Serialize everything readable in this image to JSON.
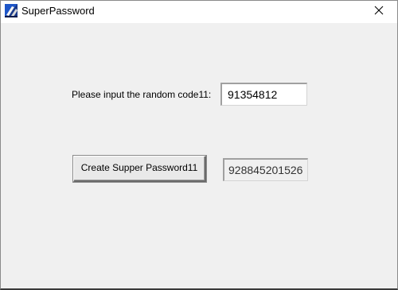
{
  "window": {
    "title": "SuperPassword",
    "app_icon": "superpassword-app-icon",
    "close_icon": "close-icon"
  },
  "form": {
    "prompt_label": "Please input the random code11:",
    "random_code_value": "91354812",
    "create_button_label": "Create Supper Password11",
    "password_output_value": "928845201526"
  },
  "colors": {
    "window_bg": "#f0f0f0",
    "titlebar_bg": "#ffffff",
    "input_bg": "#ffffff"
  }
}
